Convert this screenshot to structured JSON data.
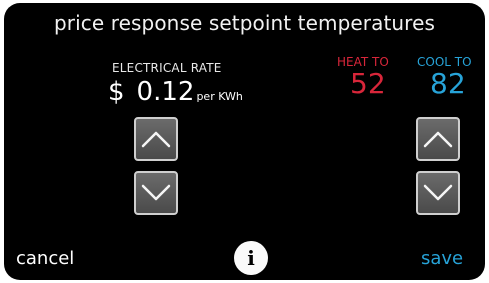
{
  "header": {
    "title": "price response setpoint temperatures"
  },
  "rate": {
    "label": "ELECTRICAL RATE",
    "currency": "$",
    "value": "0.12",
    "unit": "per KWh"
  },
  "heat": {
    "label": "HEAT TO",
    "value": "52"
  },
  "cool": {
    "label": "COOL TO",
    "value": "82"
  },
  "footer": {
    "cancel_label": "cancel",
    "info_label": "i",
    "save_label": "save"
  },
  "colors": {
    "heat": "#d8263a",
    "cool": "#27a3d8",
    "background": "#000000"
  },
  "icons": {
    "up": "chevron-up-icon",
    "down": "chevron-down-icon",
    "info": "info-icon"
  }
}
